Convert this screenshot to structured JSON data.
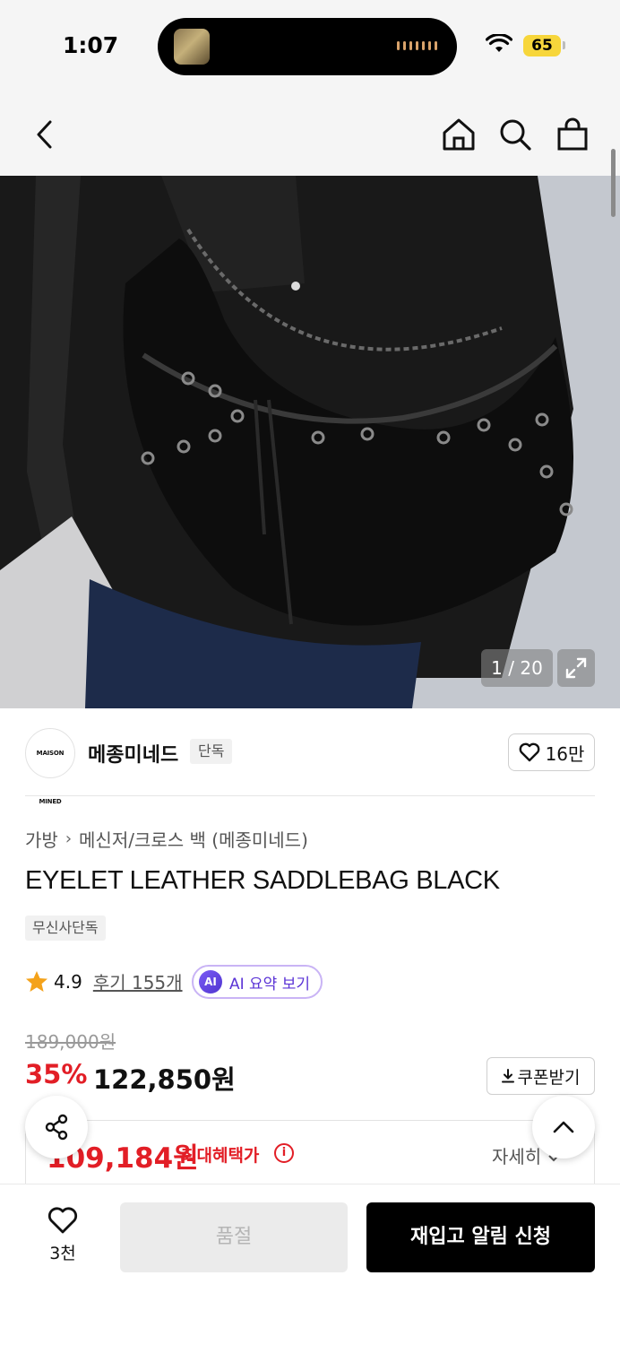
{
  "status_bar": {
    "time": "1:07",
    "battery": "65"
  },
  "nav": {
    "icons": [
      "back-arrow-icon",
      "home-icon",
      "search-icon",
      "shopping-bag-icon"
    ]
  },
  "gallery": {
    "counter": "1 / 20"
  },
  "brand": {
    "logo_text": "MAISON MINED",
    "name": "메종미네드",
    "badge": "단독",
    "like_count": "16만"
  },
  "breadcrumb": {
    "category": "가방",
    "subcategory": "메신저/크로스 백 (메종미네드)"
  },
  "product": {
    "title": "EYELET LEATHER SADDLEBAG BLACK",
    "exclusive_badge": "무신사단독",
    "rating": "4.9",
    "reviews": "후기 155개",
    "ai_summary": "AI 요약 보기",
    "ai_icon": "AI"
  },
  "price": {
    "original": "189,000원",
    "discount": "35%",
    "sale": "122,850원",
    "coupon": "쿠폰받기",
    "max_benefit_price": "109,184원",
    "max_benefit_label": "최대혜택가",
    "detail_link": "자세히"
  },
  "bottom_bar": {
    "wish_count": "3천",
    "soldout": "품절",
    "restock": "재입고 알림 신청"
  },
  "colors": {
    "accent_red": "#e21e26",
    "ai_purple": "#5b34d6",
    "primary_button": "#000000",
    "battery": "#f7d63b"
  }
}
